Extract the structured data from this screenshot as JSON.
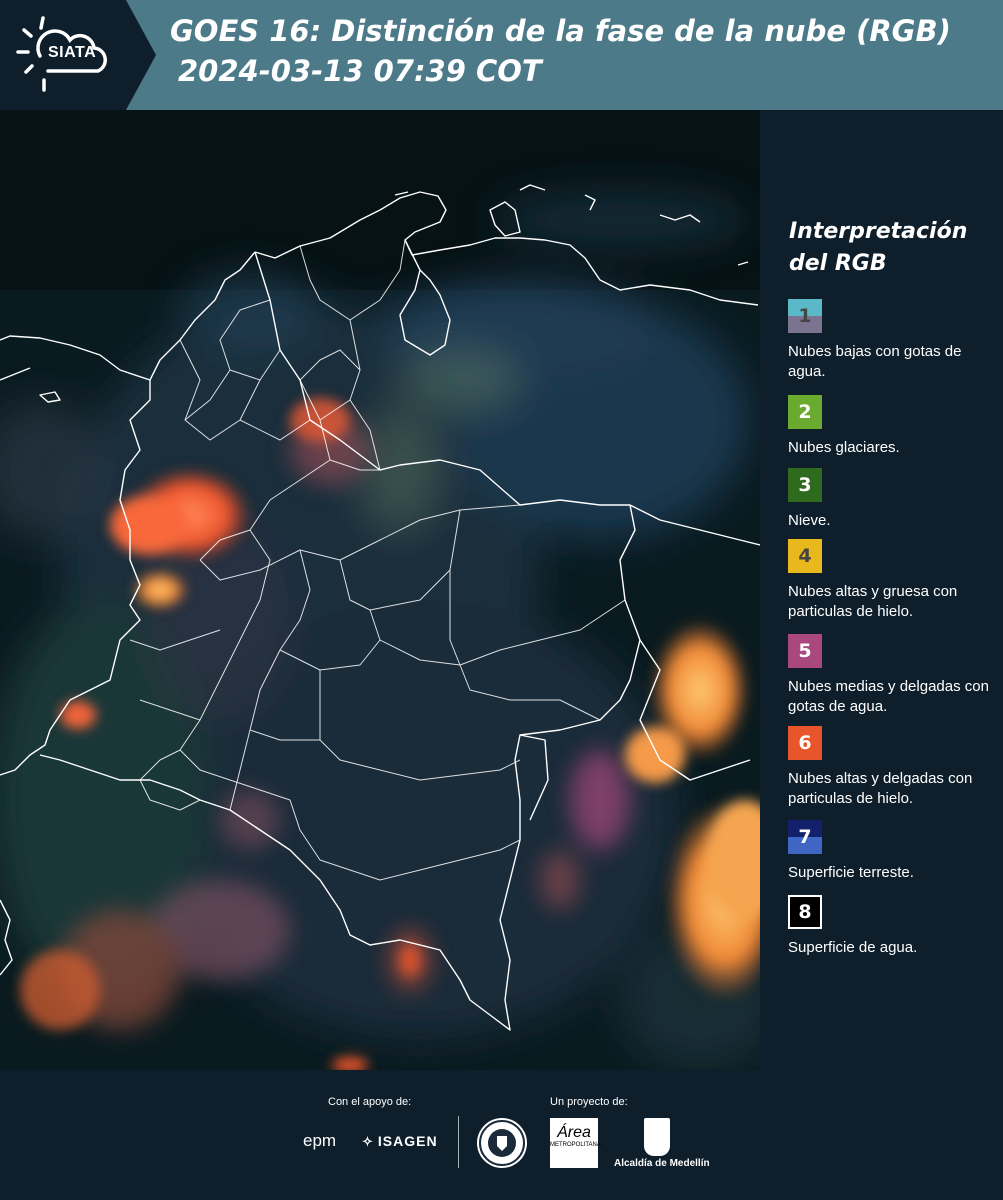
{
  "header": {
    "logo_text": "SIATA",
    "title_line1": "GOES 16: Distinción de la fase de la nube (RGB)",
    "title_line2": "2024-03-13 07:39 COT"
  },
  "legend": {
    "title": "Interpretación del RGB",
    "items": [
      {
        "num": "1",
        "label": "Nubes bajas con gotas de agua.",
        "color_top": "#5bb8c9",
        "color_bottom": "#7a7490"
      },
      {
        "num": "2",
        "label": "Nubes glaciares.",
        "color": "#6aaa2f"
      },
      {
        "num": "3",
        "label": "Nieve.",
        "color": "#2f6b1e"
      },
      {
        "num": "4",
        "label": "Nubes altas y gruesa con particulas de hielo.",
        "color": "#e8b81c"
      },
      {
        "num": "5",
        "label": "Nubes medias y delgadas con gotas de agua.",
        "color": "#a8487c"
      },
      {
        "num": "6",
        "label": "Nubes altas y delgadas con particulas de hielo.",
        "color": "#e8552a"
      },
      {
        "num": "7",
        "label": "Superficie terreste.",
        "color_top": "#13206b",
        "color_bottom": "#3f66c4"
      },
      {
        "num": "8",
        "label": "Superficie de agua.",
        "color": "#000000",
        "border": "#ffffff"
      }
    ]
  },
  "footer": {
    "support_label": "Con el apoyo de:",
    "project_label": "Un proyecto de:",
    "epm": "epm",
    "isagen": "ISAGEN",
    "amva_big": "Área",
    "amva_small": "METROPOLITANA",
    "alcaldia": "Alcaldía de Medellín"
  }
}
